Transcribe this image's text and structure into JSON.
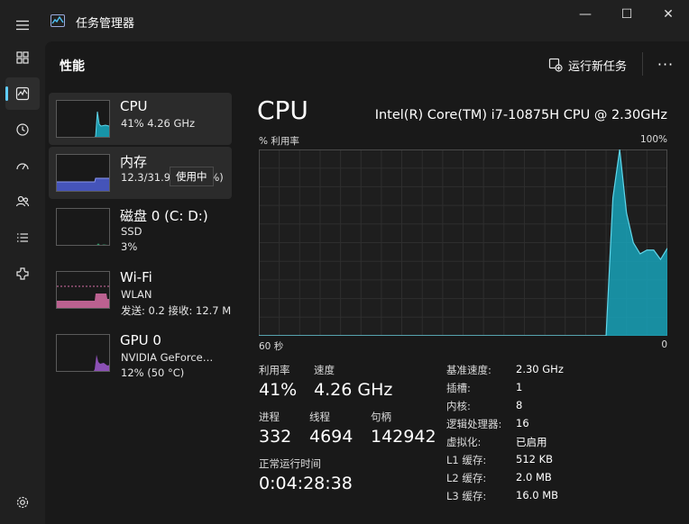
{
  "app": {
    "title": "任务管理器"
  },
  "window_buttons": {
    "minimize": "—",
    "maximize": "☐",
    "close": "✕"
  },
  "nav": [
    "hamburger-icon",
    "processes-icon",
    "performance-icon",
    "app-history-icon",
    "startup-icon",
    "users-icon",
    "details-icon",
    "services-icon",
    "settings-icon"
  ],
  "header": {
    "title": "性能",
    "run_task": "运行新任务",
    "more": "···"
  },
  "devices": [
    {
      "name": "CPU",
      "line1": "41%  4.26 GHz",
      "line2": ""
    },
    {
      "name": "内存",
      "line1": "12.3/31.9 GB (39%)",
      "line2": ""
    },
    {
      "name": "磁盘 0 (C: D:)",
      "line1": "SSD",
      "line2": "3%"
    },
    {
      "name": "Wi-Fi",
      "line1": "WLAN",
      "line2": "发送: 0.2  接收: 12.7 M"
    },
    {
      "name": "GPU 0",
      "line1": "NVIDIA GeForce…",
      "line2": "12% (50 °C)"
    }
  ],
  "tooltip": "使用中",
  "cpu": {
    "title": "CPU",
    "model": "Intel(R) Core(TM) i7-10875H CPU @ 2.30GHz",
    "graph_label": "% 利用率",
    "graph_max": "100%",
    "x_left": "60 秒",
    "x_right": "0"
  },
  "chart_data": {
    "type": "area",
    "x": [
      60,
      58,
      56,
      54,
      52,
      50,
      48,
      46,
      44,
      42,
      40,
      38,
      36,
      34,
      32,
      30,
      28,
      26,
      24,
      22,
      20,
      18,
      16,
      14,
      12,
      10,
      9,
      8,
      7,
      6,
      5,
      4,
      3,
      2,
      1,
      0
    ],
    "values": [
      0,
      0,
      0,
      0,
      0,
      0,
      0,
      0,
      0,
      0,
      0,
      0,
      0,
      0,
      0,
      0,
      0,
      0,
      0,
      0,
      0,
      0,
      0,
      0,
      0,
      0,
      0,
      74,
      100,
      66,
      50,
      44,
      46,
      46,
      41,
      47
    ],
    "ylim": [
      0,
      100
    ],
    "xlim": [
      60,
      0
    ],
    "color": "#17a2b8"
  },
  "stats": {
    "util_label": "利用率",
    "util": "41%",
    "speed_label": "速度",
    "speed": "4.26 GHz",
    "proc_label": "进程",
    "proc": "332",
    "thread_label": "线程",
    "thread": "4694",
    "handle_label": "句柄",
    "handle": "142942",
    "uptime_label": "正常运行时间",
    "uptime": "0:04:28:38"
  },
  "specs": [
    {
      "k": "基准速度:",
      "v": "2.30 GHz"
    },
    {
      "k": "插槽:",
      "v": "1"
    },
    {
      "k": "内核:",
      "v": "8"
    },
    {
      "k": "逻辑处理器:",
      "v": "16"
    },
    {
      "k": "虚拟化:",
      "v": "已启用"
    },
    {
      "k": "L1 缓存:",
      "v": "512 KB"
    },
    {
      "k": "L2 缓存:",
      "v": "2.0 MB"
    },
    {
      "k": "L3 缓存:",
      "v": "16.0 MB"
    }
  ],
  "colors": {
    "cpu": "#17a2b8",
    "memory": "#4e5fd6",
    "disk": "#2f9e6b",
    "wifi": "#d86fa6",
    "gpu": "#a05bd0"
  }
}
